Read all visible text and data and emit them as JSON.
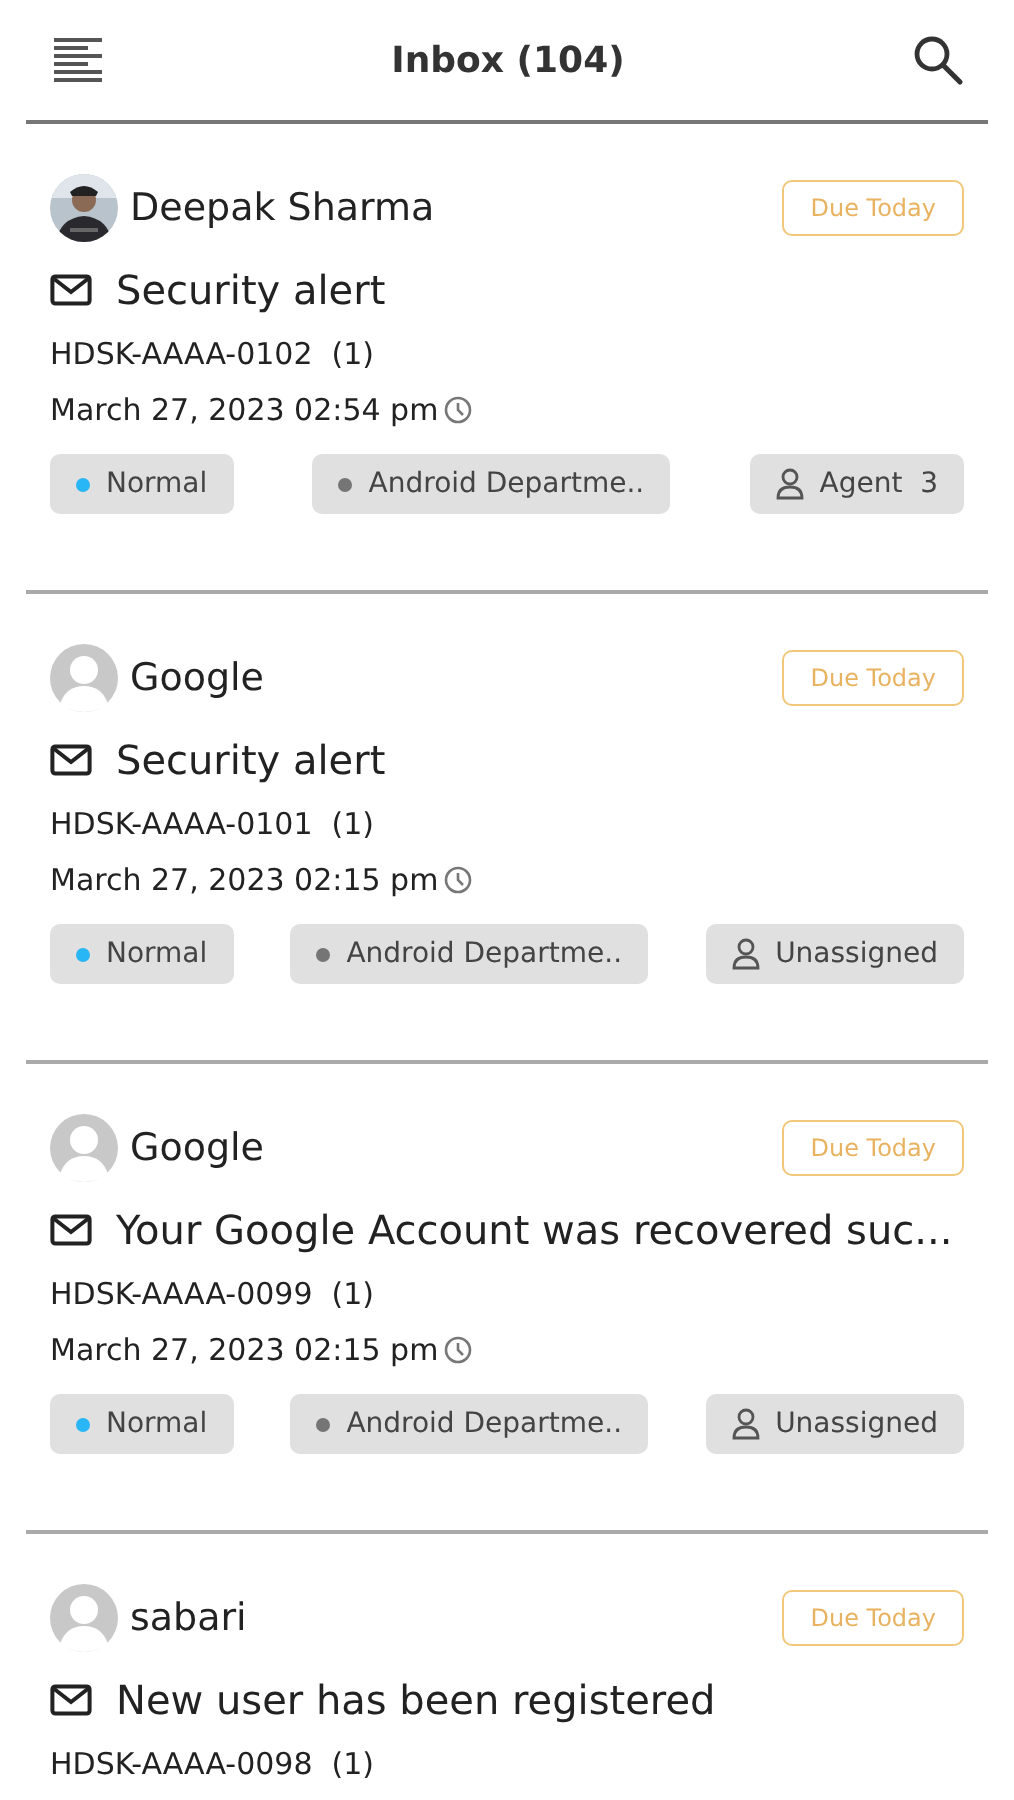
{
  "header": {
    "title": "Inbox (104)"
  },
  "tickets": [
    {
      "sender": "Deepak Sharma",
      "avatar": {
        "kind": "picture"
      },
      "due": "Due Today",
      "subject": "Security alert",
      "ticket_id": "HDSK-AAAA-0102",
      "count": "(1)",
      "date": "March 27, 2023 02:54 pm",
      "tags": [
        {
          "kind": "priority",
          "label": "Normal",
          "color": "#29b6f6"
        },
        {
          "kind": "department",
          "label": "Android Departme..",
          "color": "#757575"
        },
        {
          "kind": "agent",
          "label": "Agent  3"
        }
      ]
    },
    {
      "sender": "Google",
      "avatar": {
        "kind": "default"
      },
      "due": "Due Today",
      "subject": "Security alert",
      "ticket_id": "HDSK-AAAA-0101",
      "count": "(1)",
      "date": "March 27, 2023 02:15 pm",
      "tags": [
        {
          "kind": "priority",
          "label": "Normal",
          "color": "#29b6f6"
        },
        {
          "kind": "department",
          "label": "Android Departme..",
          "color": "#757575"
        },
        {
          "kind": "agent",
          "label": "Unassigned"
        }
      ]
    },
    {
      "sender": "Google",
      "avatar": {
        "kind": "default"
      },
      "due": "Due Today",
      "subject": "Your Google Account was recovered suc...",
      "ticket_id": "HDSK-AAAA-0099",
      "count": "(1)",
      "date": "March 27, 2023 02:15 pm",
      "tags": [
        {
          "kind": "priority",
          "label": "Normal",
          "color": "#29b6f6"
        },
        {
          "kind": "department",
          "label": "Android Departme..",
          "color": "#757575"
        },
        {
          "kind": "agent",
          "label": "Unassigned"
        }
      ]
    },
    {
      "sender": "sabari",
      "avatar": {
        "kind": "default"
      },
      "due": "Due Today",
      "subject": "New user has been registered",
      "ticket_id": "HDSK-AAAA-0098",
      "count": "(1)"
    }
  ]
}
